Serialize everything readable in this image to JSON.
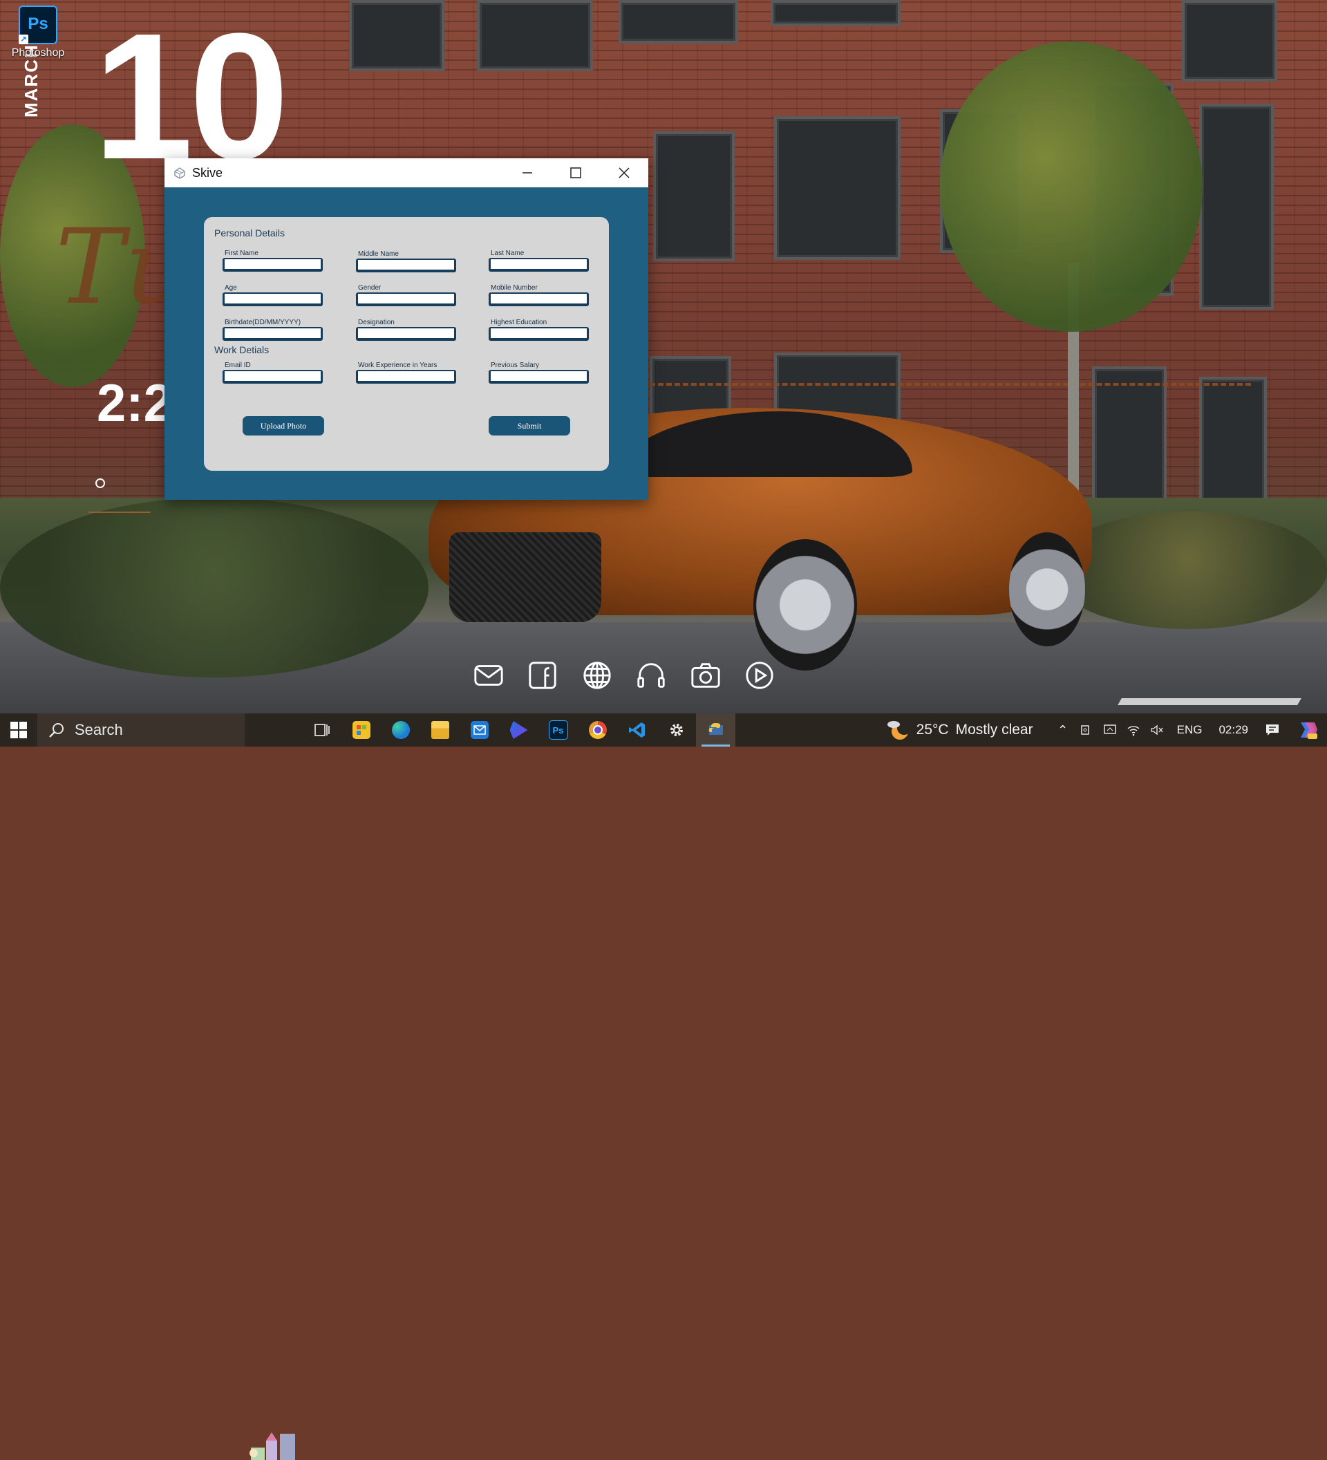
{
  "desktop": {
    "widget": {
      "day": "10",
      "month": "MARCH",
      "time_partial": "2:2",
      "script_text": "Tue"
    },
    "icons": [
      {
        "label": "Photoshop",
        "icon": "photoshop-icon"
      }
    ],
    "dock": [
      "mail-icon",
      "facebook-icon",
      "globe-icon",
      "headphones-icon",
      "camera-icon",
      "play-icon"
    ]
  },
  "window": {
    "title": "Skive",
    "controls": [
      "minimize",
      "maximize",
      "close"
    ],
    "form": {
      "personal_title": "Personal Details",
      "work_title": "Work Detials",
      "fields": {
        "first_name": {
          "label": "First Name",
          "value": ""
        },
        "middle_name": {
          "label": "Middle Name",
          "value": ""
        },
        "last_name": {
          "label": "Last Name",
          "value": ""
        },
        "age": {
          "label": "Age",
          "value": ""
        },
        "gender": {
          "label": "Gender",
          "value": ""
        },
        "mobile_number": {
          "label": "Mobile Number",
          "value": ""
        },
        "birthdate": {
          "label": "Birthdate(DD/MM/YYYY)",
          "value": ""
        },
        "designation": {
          "label": "Designation",
          "value": ""
        },
        "highest_education": {
          "label": "Highest Education",
          "value": ""
        },
        "email_id": {
          "label": "Email ID",
          "value": ""
        },
        "work_experience": {
          "label": "Work Experience in Years",
          "value": ""
        },
        "previous_salary": {
          "label": "Previous Salary",
          "value": ""
        }
      },
      "upload_label": "Upload Photo",
      "submit_label": "Submit"
    },
    "colors": {
      "window_bg": "#1f5f82",
      "panel_bg": "#d6d6d6",
      "button_bg": "#1a5578"
    }
  },
  "taskbar": {
    "search_label": "Search",
    "apps": [
      {
        "name": "task-view",
        "icon": "task-view-icon"
      },
      {
        "name": "microsoft-store",
        "icon": "store-icon"
      },
      {
        "name": "edge",
        "icon": "edge-icon"
      },
      {
        "name": "file-explorer",
        "icon": "folder-icon"
      },
      {
        "name": "mail",
        "icon": "mail-icon"
      },
      {
        "name": "power-automate",
        "icon": "power-automate-icon"
      },
      {
        "name": "photoshop",
        "icon": "photoshop-icon",
        "glyph": "Ps"
      },
      {
        "name": "chrome-canary",
        "icon": "chrome-icon"
      },
      {
        "name": "vscode",
        "icon": "vscode-icon"
      },
      {
        "name": "settings",
        "icon": "gear-icon"
      },
      {
        "name": "skive",
        "icon": "python-icon",
        "active": true
      }
    ],
    "weather": {
      "temp": "25°C",
      "condition": "Mostly clear"
    },
    "language": "ENG",
    "clock": "02:29"
  }
}
